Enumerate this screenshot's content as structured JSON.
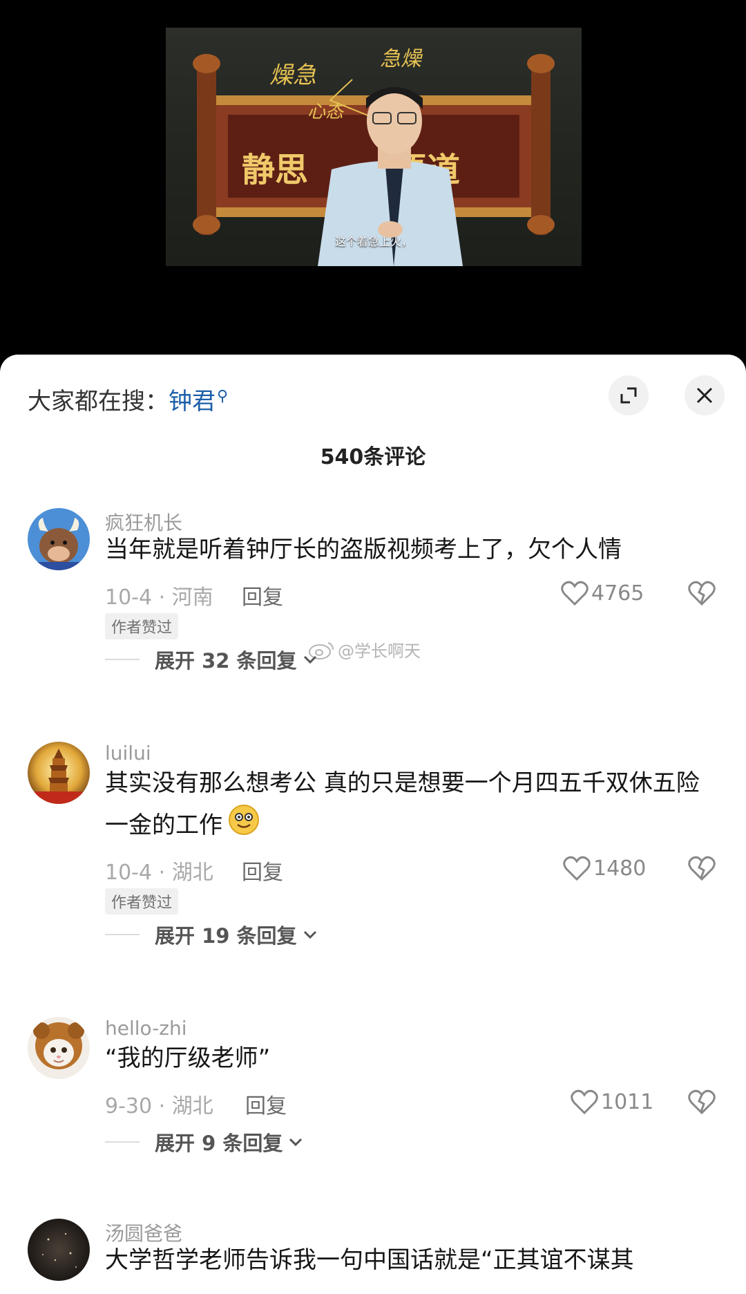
{
  "video": {
    "board_words": [
      "静思",
      "悟道"
    ],
    "handwriting": [
      "燥急",
      "急燥",
      "心态"
    ],
    "caption": "这个着急上火，"
  },
  "sheet": {
    "search_prefix": "大家都在搜：",
    "search_keyword": "钟君",
    "comment_count": "540条评论",
    "watermark": "@学长啊天"
  },
  "comments": [
    {
      "username": "疯狂机长",
      "text": "当年就是听着钟厅长的盗版视频考上了，欠个人情",
      "meta": "10-4 · 河南",
      "reply": "回复",
      "likes": "4765",
      "badge": "作者赞过",
      "expand": "展开 32 条回复"
    },
    {
      "username": "luilui",
      "text": "其实没有那么想考公 真的只是想要一个月四五千双休五险一金的工作",
      "meta": "10-4 · 湖北",
      "reply": "回复",
      "likes": "1480",
      "badge": "作者赞过",
      "expand": "展开 19 条回复"
    },
    {
      "username": "hello-zhi",
      "text": "“我的厅级老师”",
      "meta": "9-30 · 湖北",
      "reply": "回复",
      "likes": "1011",
      "expand": "展开 9 条回复"
    },
    {
      "username": "汤圆爸爸",
      "text": "大学哲学老师告诉我一句中国话就是“正其谊不谋其"
    }
  ],
  "icons": {
    "expand": "expand-icon",
    "close": "close-icon",
    "like": "heart-icon",
    "dislike": "broken-heart-icon",
    "chevron": "chevron-down-icon"
  }
}
